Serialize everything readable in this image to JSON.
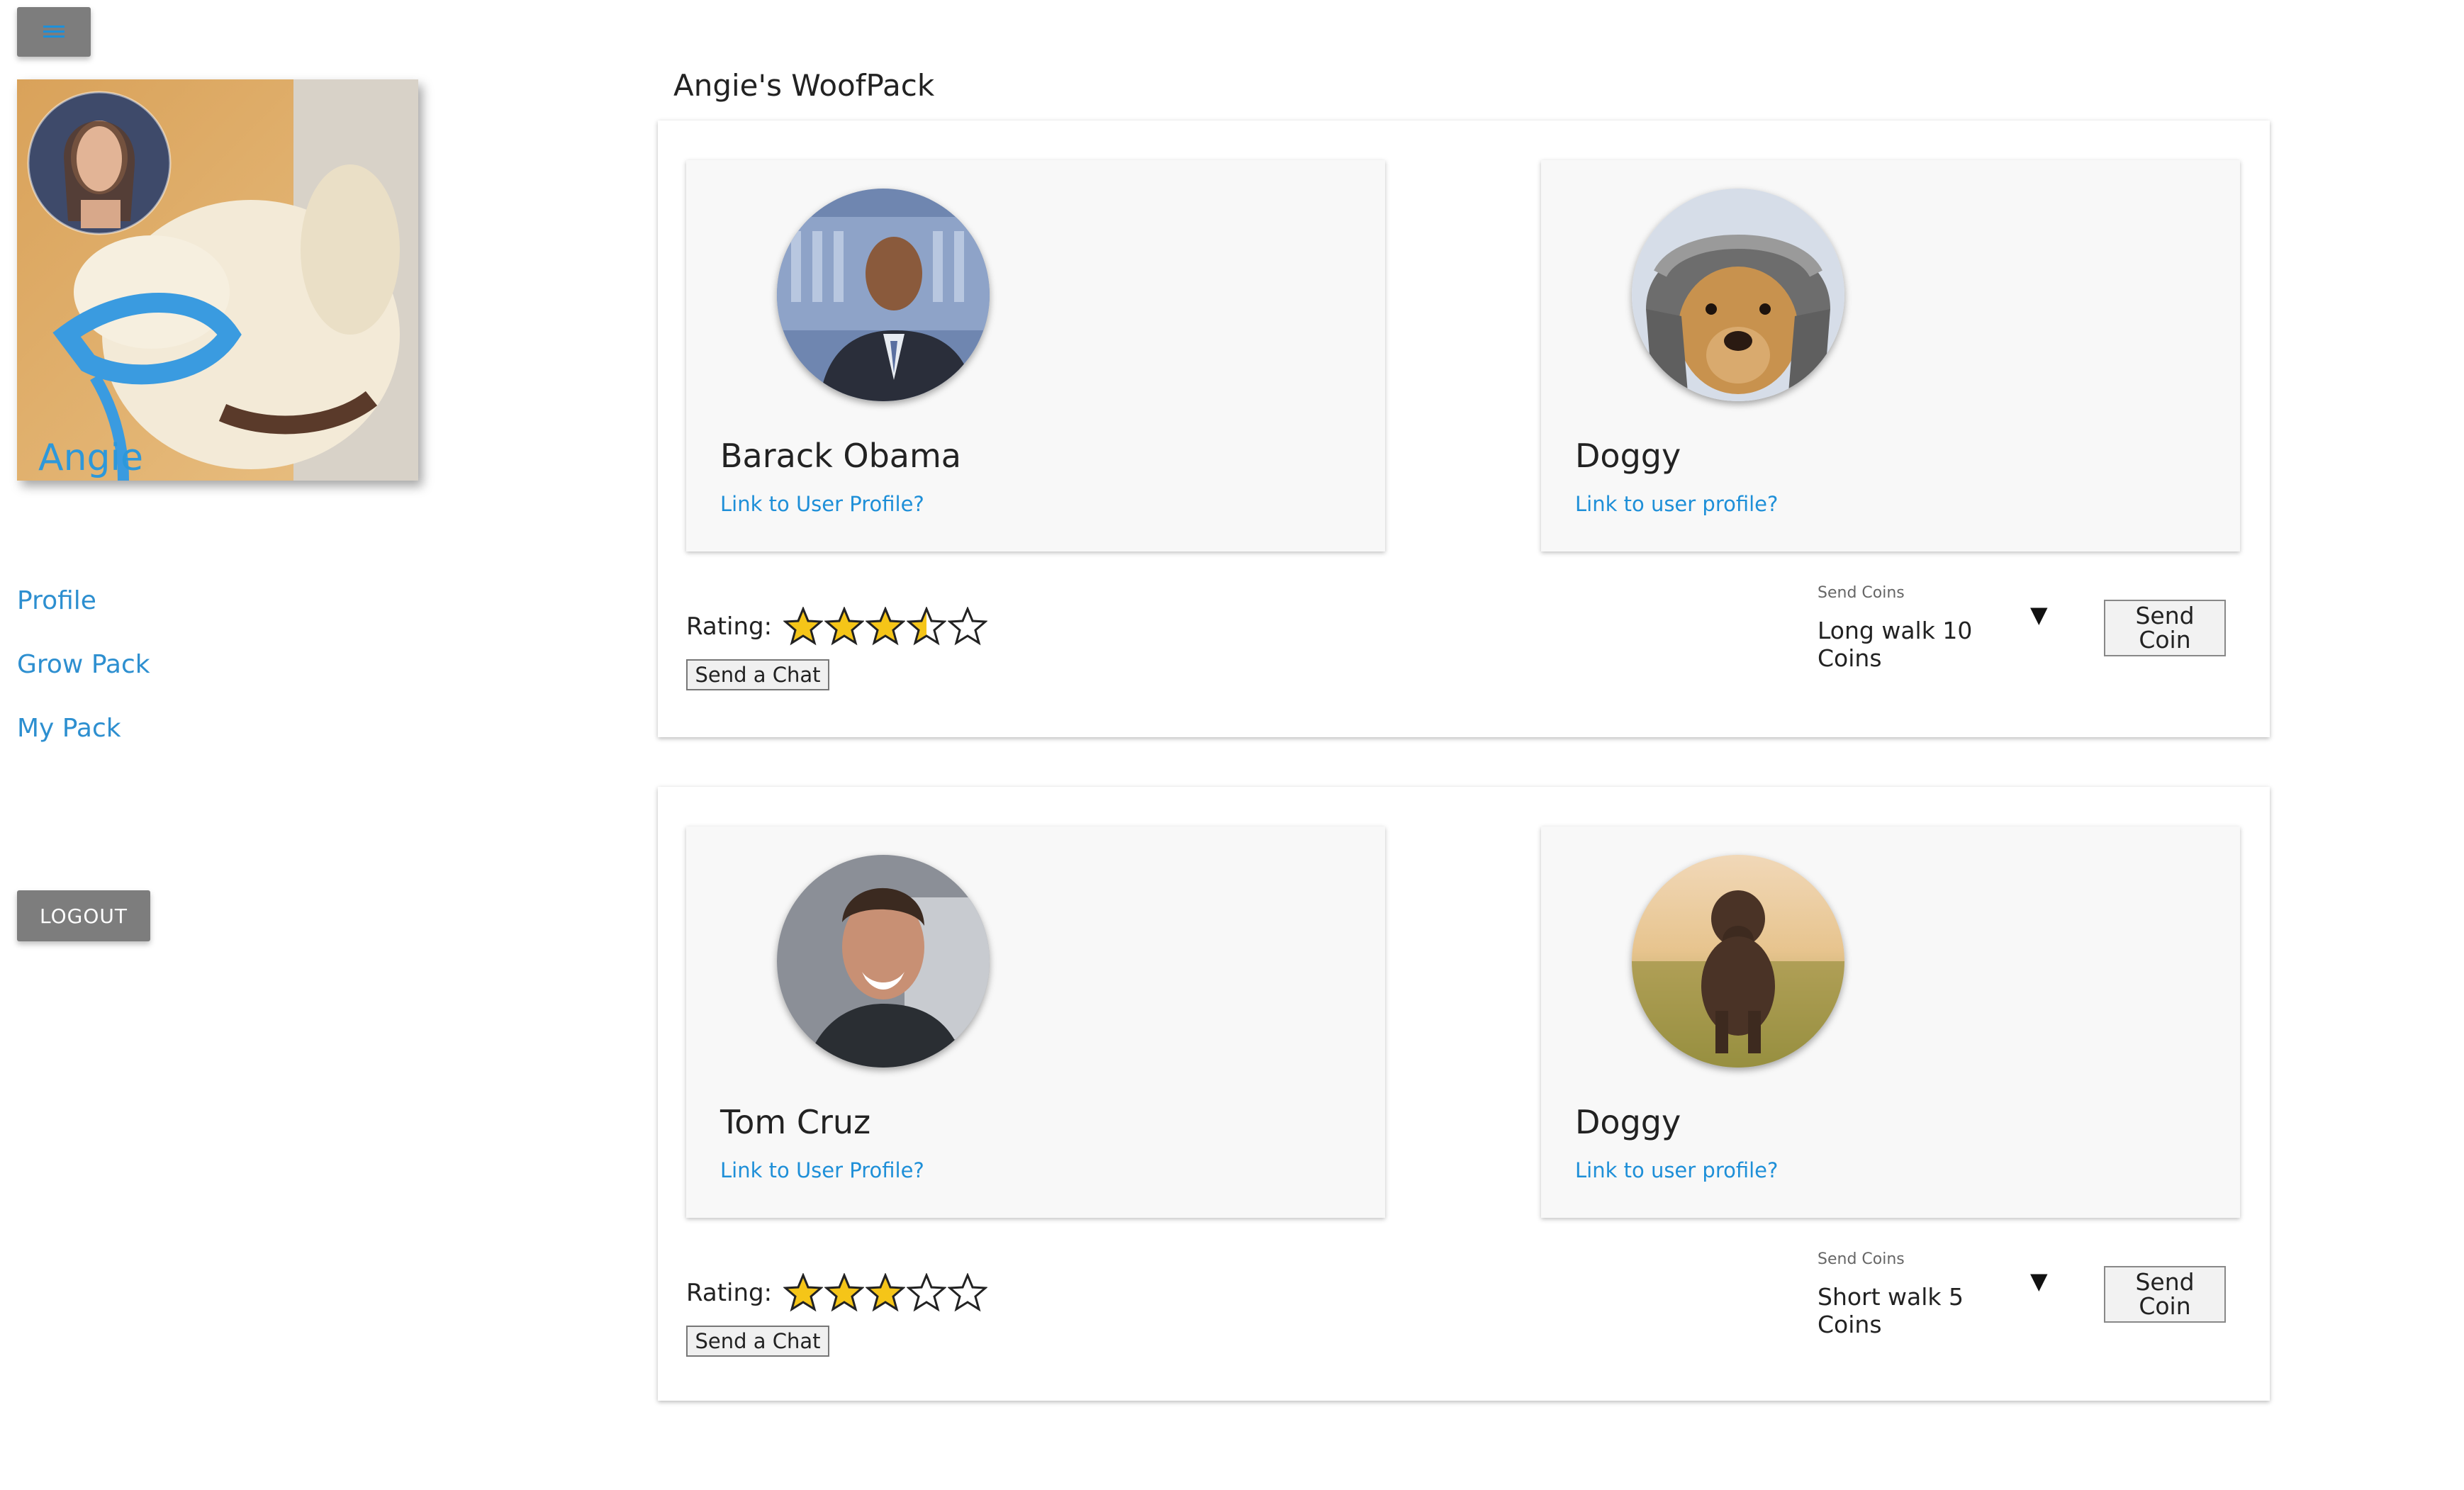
{
  "sidebar": {
    "menu_icon": "hamburger-icon",
    "profile_name": "Angie",
    "nav": [
      {
        "label": "Profile"
      },
      {
        "label": "Grow Pack"
      },
      {
        "label": "My Pack"
      }
    ],
    "logout_label": "LOGOUT"
  },
  "main": {
    "title": "Angie's WoofPack",
    "packs": [
      {
        "person": {
          "name": "Barack Obama",
          "link": "Link to User Profile?"
        },
        "dog": {
          "name": "Doggy",
          "link": "Link to user profile?"
        },
        "rating_label": "Rating:",
        "rating": 3.5,
        "rating_max": 5,
        "chat_label": "Send a Chat",
        "coins_label": "Send Coins",
        "coins_value": "Long walk 10 Coins",
        "send_coin_line1": "Send",
        "send_coin_line2": "Coin"
      },
      {
        "person": {
          "name": "Tom Cruz",
          "link": "Link to User Profile?"
        },
        "dog": {
          "name": "Doggy",
          "link": "Link to user profile?"
        },
        "rating_label": "Rating:",
        "rating": 3,
        "rating_max": 5,
        "chat_label": "Send a Chat",
        "coins_label": "Send Coins",
        "coins_value": "Short walk 5 Coins",
        "send_coin_line1": "Send",
        "send_coin_line2": "Coin"
      }
    ]
  },
  "colors": {
    "accent": "#2d8fd0",
    "button_gray": "#7d7d7d",
    "star_fill": "#f5c518"
  }
}
